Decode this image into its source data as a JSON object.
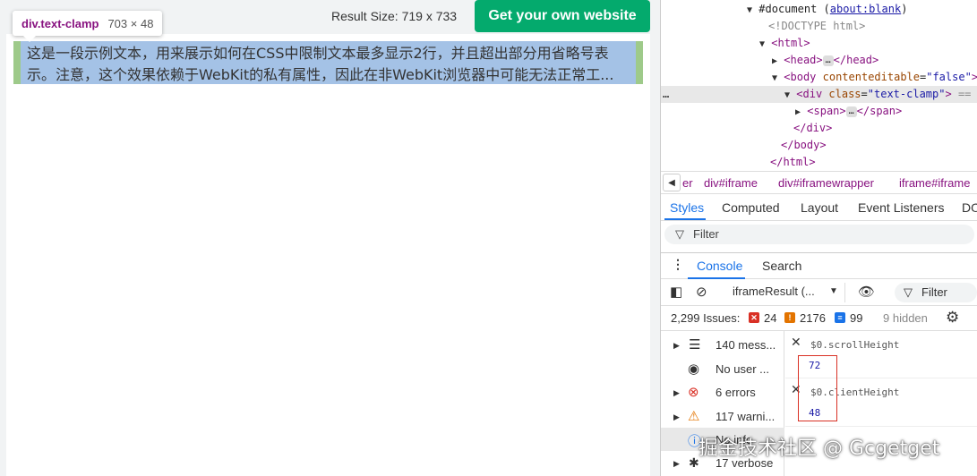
{
  "result_bar": {
    "result_size": "Result Size: 719 x 733",
    "cta_label": "Get your own website"
  },
  "inspector_tooltip": {
    "selector": "div.text-clamp",
    "dimensions": "703 × 48"
  },
  "preview": {
    "line1": "这是一段示例文本，用来展示如何在CSS中限制文本最多显示2行，并且超出部分用省略号表",
    "line2": "示。注意，这个效果依赖于WebKit的私有属性，因此在非WebKit浏览器中可能无法正常工..."
  },
  "dom_tree": {
    "document": "#document",
    "document_link": "about:blank",
    "doctype": "<!DOCTYPE html>",
    "html_open": "<html>",
    "head_open": "<head>",
    "head_close": "</head>",
    "body_open_tag": "<body",
    "body_attr_name": "contenteditable",
    "body_attr_value": "\"false\"",
    "body_open_end": ">",
    "div_open_tag": "<div",
    "div_attr_name": "class",
    "div_attr_value": "\"text-clamp\"",
    "div_open_end": ">",
    "div_suffix": "== $0",
    "span_open": "<span>",
    "span_close": "</span>",
    "div_close": "</div>",
    "body_close": "</body>",
    "html_close": "</html>",
    "ellipsis": "…",
    "row_menu": "…"
  },
  "breadcrumbs": [
    "er",
    "div#iframe",
    "div#iframewrapper",
    "iframe#iframe"
  ],
  "styles_tabs": [
    "Styles",
    "Computed",
    "Layout",
    "Event Listeners",
    "DO"
  ],
  "styles_filter_placeholder": "Filter",
  "drawer_tabs": [
    "Console",
    "Search"
  ],
  "console_toolbar": {
    "context": "iframeResult (...",
    "filter_placeholder": "Filter"
  },
  "issues_bar": {
    "label": "2,299 Issues:",
    "errors": "24",
    "warnings": "2176",
    "info": "99",
    "hidden": "9 hidden"
  },
  "console_sidebar": [
    {
      "label": "140 mess...",
      "icon": "list-icon"
    },
    {
      "label": "No user ...",
      "icon": "user-icon"
    },
    {
      "label": "6 errors",
      "icon": "error-icon"
    },
    {
      "label": "117 warni...",
      "icon": "warning-icon"
    },
    {
      "label": "No info",
      "icon": "info-icon"
    },
    {
      "label": "17 verbose",
      "icon": "bug-icon"
    }
  ],
  "console_entries": [
    {
      "expression": "$0.scrollHeight",
      "result": "72"
    },
    {
      "expression": "$0.clientHeight",
      "result": "48"
    }
  ],
  "watermark": "掘金技术社区 @ Gcgetget",
  "colors": {
    "brand_green": "#04aa6d",
    "selection_blue": "#a4c2e6",
    "padding_green": "#93c47d",
    "devtools_accent": "#1a73e8",
    "tag_purple": "#881280",
    "highlight_red": "#d93025"
  }
}
